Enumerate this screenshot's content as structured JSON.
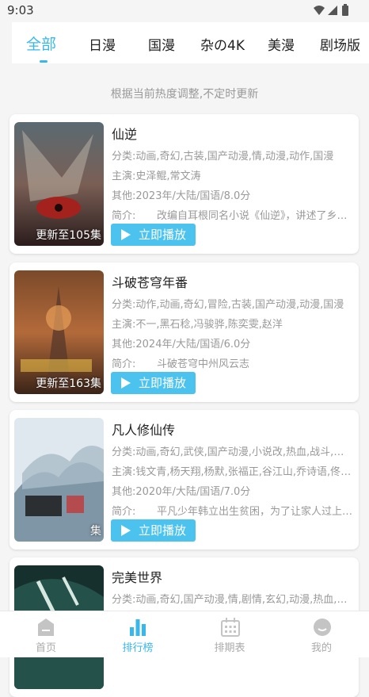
{
  "status_bar": {
    "time": "9:03"
  },
  "category_tabs": [
    {
      "label": "全部",
      "active": true
    },
    {
      "label": "日漫",
      "active": false
    },
    {
      "label": "国漫",
      "active": false
    },
    {
      "label": "杂の4K",
      "active": false
    },
    {
      "label": "美漫",
      "active": false
    },
    {
      "label": "剧场版",
      "active": false
    }
  ],
  "subtitle": "根据当前热度调整,不定时更新",
  "play_button_label": "立即播放",
  "intro_label": "简介:",
  "items": [
    {
      "title": "仙逆",
      "category": "分类:动画,奇幻,古装,国产动漫,情,动漫,动作,国漫",
      "cast": "主演:史泽鲲,常文涛",
      "other": "其他:2023年/大陆/国语/8.0分",
      "intro": "改编自耳根同名小说《仙逆》，讲述了乡村平凡少年王林",
      "episode_badge": "更新至105集"
    },
    {
      "title": "斗破苍穹年番",
      "category": "分类:动作,动画,奇幻,冒险,古装,国产动漫,动漫,国漫",
      "cast": "主演:不一,黑石稔,冯骏骅,陈奕雯,赵洋",
      "other": "其他:2024年/大陆/国语/6.0分",
      "intro": "斗破苍穹中州风云志",
      "episode_badge": "更新至163集"
    },
    {
      "title": "凡人修仙传",
      "category": "分类:动画,奇幻,武侠,国产动漫,小说改,热血,战斗,玄幻,国漫",
      "cast": "主演:钱文青,杨天翔,杨默,张福正,谷江山,乔诗语,佟心竹",
      "other": "其他:2020年/大陆/国语/7.0分",
      "intro": "平凡少年韩立出生贫困，为了让家人过上更好的生活",
      "episode_badge": "集"
    },
    {
      "title": "完美世界",
      "category": "分类:动画,奇幻,国产动漫,情,剧情,玄幻,动漫,热血,青春,国漫",
      "cast": "",
      "other": "",
      "intro": "",
      "episode_badge": ""
    }
  ],
  "bottom_nav": [
    {
      "label": "首页",
      "icon": "home-icon",
      "active": false
    },
    {
      "label": "排行榜",
      "icon": "bar-chart-icon",
      "active": true
    },
    {
      "label": "排期表",
      "icon": "calendar-icon",
      "active": false
    },
    {
      "label": "我的",
      "icon": "face-icon",
      "active": false
    }
  ],
  "colors": {
    "accent": "#3ab7ea",
    "play_button": "#4cc2ef",
    "muted_text": "#999999"
  }
}
